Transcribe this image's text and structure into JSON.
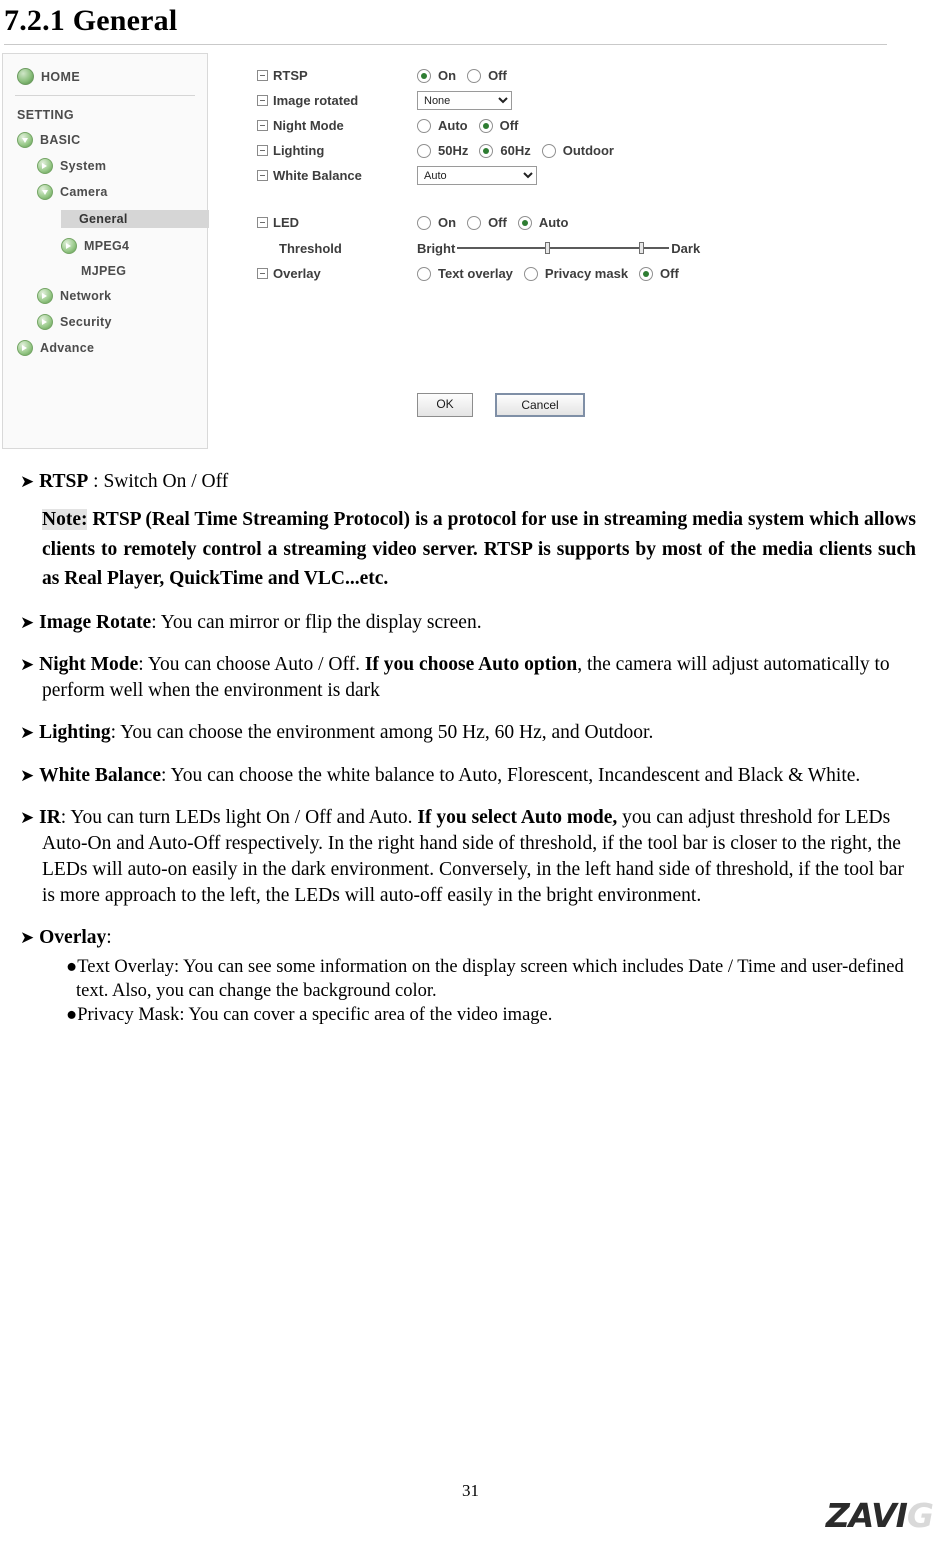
{
  "heading": "7.2.1 General",
  "screenshot": {
    "sidebar": {
      "home": "HOME",
      "setting": "SETTING",
      "items": [
        {
          "label": "BASIC",
          "icon": "arrow-down-icon"
        },
        {
          "label": "System",
          "icon": "arrow-right-icon"
        },
        {
          "label": "Camera",
          "icon": "arrow-down-icon"
        },
        {
          "label": "General",
          "icon": "none"
        },
        {
          "label": "MPEG4",
          "icon": "arrow-right-icon"
        },
        {
          "label": "MJPEG",
          "icon": "none"
        },
        {
          "label": "Network",
          "icon": "arrow-right-icon"
        },
        {
          "label": "Security",
          "icon": "arrow-right-icon"
        },
        {
          "label": "Advance",
          "icon": "arrow-right-icon"
        }
      ]
    },
    "form": {
      "rtsp": {
        "label": "RTSP",
        "options": [
          "On",
          "Off"
        ],
        "selected": "On"
      },
      "image_rotated": {
        "label": "Image rotated",
        "value": "None"
      },
      "night_mode": {
        "label": "Night Mode",
        "options": [
          "Auto",
          "Off"
        ],
        "selected": "Off"
      },
      "lighting": {
        "label": "Lighting",
        "options": [
          "50Hz",
          "60Hz",
          "Outdoor"
        ],
        "selected": "60Hz"
      },
      "white_balance": {
        "label": "White Balance",
        "value": "Auto"
      },
      "led": {
        "label": "LED",
        "options": [
          "On",
          "Off",
          "Auto"
        ],
        "selected": "Auto"
      },
      "threshold": {
        "label": "Threshold",
        "left": "Bright",
        "right": "Dark"
      },
      "overlay": {
        "label": "Overlay",
        "options": [
          "Text overlay",
          "Privacy mask",
          "Off"
        ],
        "selected": "Off"
      },
      "ok": "OK",
      "cancel": "Cancel"
    }
  },
  "body": {
    "rtsp_bullet_title": "RTSP",
    "rtsp_bullet_rest": " : Switch On / Off",
    "note_label": "Note:",
    "note_text": " RTSP (Real Time Streaming Protocol) is a protocol for use in streaming media system which allows clients to remotely control a streaming video server. RTSP is supports by most of the media clients such as Real Player, QuickTime and VLC...etc.",
    "image_rotate_title": "Image Rotate",
    "image_rotate_rest": ": You can mirror or flip the display screen.",
    "night_mode_title": "Night Mode",
    "night_mode_part1": ": You can choose Auto / Off. ",
    "night_mode_bold": "If you choose Auto option",
    "night_mode_part2": ", the camera will adjust automatically to perform well when the environment is dark",
    "lighting_title": "Lighting",
    "lighting_rest": ": You can choose the environment among 50 Hz, 60 Hz, and Outdoor.",
    "white_balance_title": "White Balance",
    "white_balance_rest": ": You can choose the white balance to Auto, Florescent, Incandescent and Black & White.",
    "ir_title": "IR",
    "ir_part1": ": You can turn LEDs light On / Off and Auto. ",
    "ir_bold": "If you select Auto mode,",
    "ir_part2": " you can adjust threshold for LEDs Auto-On and Auto-Off respectively. In the right hand side of threshold, if the tool bar is closer to the right, the LEDs will auto-on easily in the dark environment. Conversely, in the left hand side of threshold, if the tool bar is more approach to the left, the LEDs will auto-off easily in the bright environment.",
    "overlay_title": "Overlay",
    "overlay_rest": ":",
    "overlay_text_item": "Text Overlay: You can see some information on the display screen which includes Date / Time and user-defined text. Also, you can change the background color.",
    "overlay_privacy_item": "Privacy Mask: You can cover a specific area of the video image."
  },
  "footer": {
    "page_number": "31",
    "logo_main": "ZAVI",
    "logo_last": "G"
  }
}
